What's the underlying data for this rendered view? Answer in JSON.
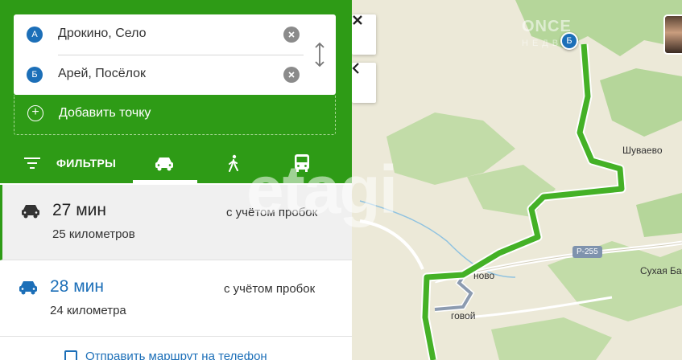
{
  "route_form": {
    "point_a": {
      "marker": "А",
      "value": "Дрокино, Село"
    },
    "point_b": {
      "marker": "Б",
      "value": "Арей, Посёлок"
    },
    "add_point": "Добавить точку"
  },
  "modes": {
    "filters_label": "ФИЛЬТРЫ",
    "items": [
      {
        "name": "car-icon",
        "active": true
      },
      {
        "name": "pedestrian-icon",
        "active": false
      },
      {
        "name": "bus-icon",
        "active": false
      }
    ]
  },
  "routes": [
    {
      "time": "27 мин",
      "distance": "25 километров",
      "traffic": "с учётом пробок",
      "selected": true
    },
    {
      "time": "28 мин",
      "distance": "24 километра",
      "traffic": "с учётом пробок",
      "selected": false
    }
  ],
  "send_to_phone": "Отправить маршрут на телефон",
  "map": {
    "labels": {
      "shuvaevo": "Шуваево",
      "road": "Р-255",
      "sukhaya": "Сухая Ба",
      "vovo": "ново",
      "govoy": "говой"
    },
    "end_marker": "Б"
  },
  "watermarks": {
    "etagi": "etagi",
    "logo": "ONCE",
    "logo_sub": "НЕДВИЖ"
  },
  "colors": {
    "primary_green": "#2e9b16",
    "route_green": "#44b126",
    "marker_blue": "#1c6fb8"
  }
}
